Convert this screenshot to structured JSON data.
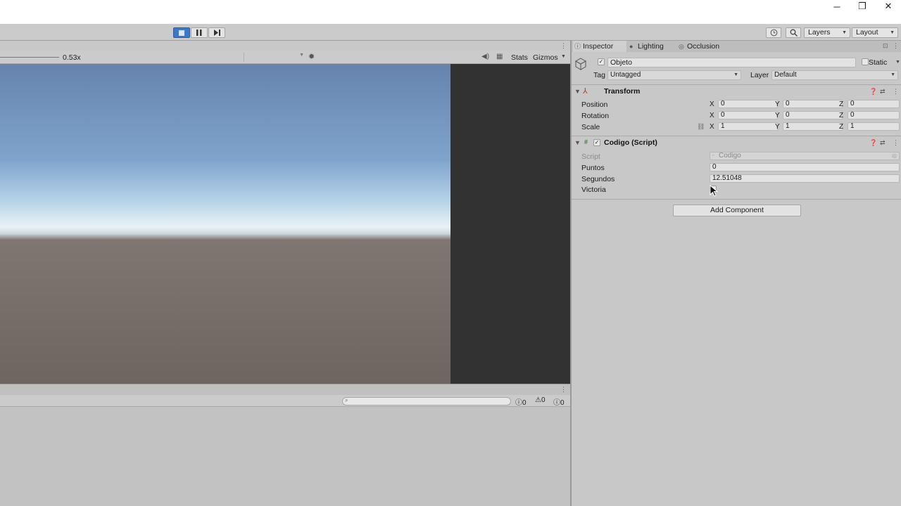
{
  "window": {
    "minimize_glyph": "─",
    "restore_glyph": "❐",
    "close_glyph": "✕"
  },
  "toolbar": {
    "layers_label": "Layers",
    "layout_label": "Layout"
  },
  "game_view": {
    "scale_value": "0.53x",
    "stats_label": "Stats",
    "gizmos_label": "Gizmos"
  },
  "console": {
    "error_count": "0",
    "warning_count": "0",
    "message_count": "0"
  },
  "inspector": {
    "tabs": [
      {
        "label": "Inspector",
        "icon": "info-icon"
      },
      {
        "label": "Lighting",
        "icon": "bulb-icon"
      },
      {
        "label": "Occlusion",
        "icon": "occlusion-icon"
      }
    ],
    "object": {
      "name": "Objeto",
      "active": true,
      "static_label": "Static",
      "tag_label": "Tag",
      "tag_value": "Untagged",
      "layer_label": "Layer",
      "layer_value": "Default"
    },
    "transform": {
      "title": "Transform",
      "rows": [
        {
          "label": "Position",
          "x": "0",
          "y": "0",
          "z": "0"
        },
        {
          "label": "Rotation",
          "x": "0",
          "y": "0",
          "z": "0"
        },
        {
          "label": "Scale",
          "x": "1",
          "y": "1",
          "z": "1"
        }
      ],
      "axis_x": "X",
      "axis_y": "Y",
      "axis_z": "Z"
    },
    "script_component": {
      "title": "Codigo (Script)",
      "enabled": true,
      "script_label": "Script",
      "script_value": "Codigo",
      "puntos_label": "Puntos",
      "puntos_value": "0",
      "segundos_label": "Segundos",
      "segundos_value": "12.51048",
      "victoria_label": "Victoria"
    },
    "add_component_label": "Add Component"
  },
  "colors": {
    "play_active": "#3d78c8",
    "panel_bg": "#c8c8c8",
    "letterbox": "#323232"
  }
}
